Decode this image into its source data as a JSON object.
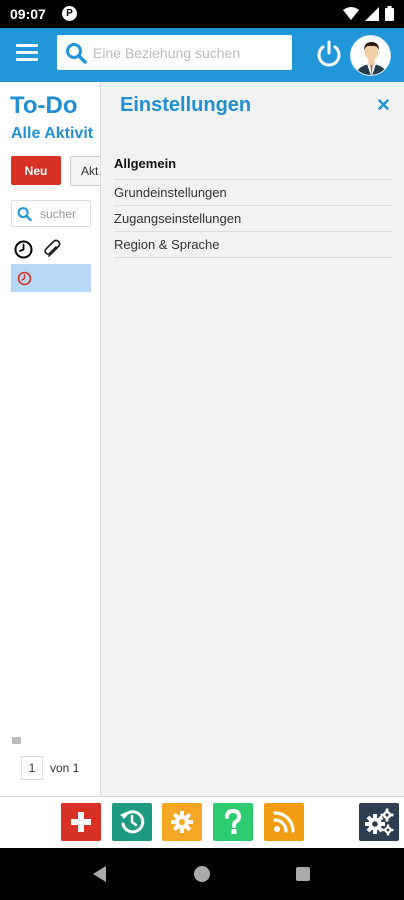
{
  "status_bar": {
    "time": "09:07",
    "notification_badge": "P"
  },
  "app_bar": {
    "search_placeholder": "Eine Beziehung suchen"
  },
  "left_panel": {
    "title": "To-Do",
    "subtitle": "Alle Aktivit",
    "new_button": "Neu",
    "action_button": "Akt",
    "search_placeholder": "sucher",
    "pagination": {
      "page": "1",
      "of_label": "von 1"
    }
  },
  "settings": {
    "title": "Einstellungen",
    "close": "×",
    "section_heading": "Allgemein",
    "items": [
      {
        "label": "Grundeinstellungen"
      },
      {
        "label": "Zugangseinstellungen"
      },
      {
        "label": "Region & Sprache"
      }
    ]
  },
  "toolbar": {
    "buttons": [
      {
        "icon": "plus-icon",
        "color": "#d93025"
      },
      {
        "icon": "history-icon",
        "color": "#1e9a80"
      },
      {
        "icon": "gear-icon",
        "color": "#f5a623"
      },
      {
        "icon": "help-icon",
        "color": "#2ecc71"
      },
      {
        "icon": "rss-icon",
        "color": "#f39c12"
      },
      {
        "icon": "settings-gears-icon",
        "color": "#2c3e50"
      }
    ]
  },
  "colors": {
    "accent": "#2196d9",
    "title_blue": "#1f8fd6",
    "danger": "#d93025",
    "selection": "#b8d8f8"
  }
}
